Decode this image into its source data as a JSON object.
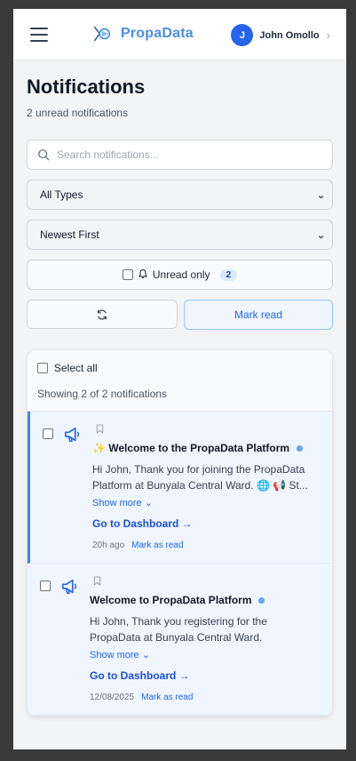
{
  "header": {
    "brand": "PropaData",
    "user_initial": "J",
    "user_name": "John Omollo",
    "chevron": "›",
    "accent": "#4a90e2",
    "avatar_color": "#2563eb"
  },
  "page": {
    "title": "Notifications",
    "subtitle": "2 unread notifications"
  },
  "filters": {
    "search_placeholder": "Search notifications...",
    "type_select": "All Types",
    "sort_select": "Newest First",
    "unread_only_label": "Unread only",
    "unread_count": "2",
    "mark_read_label": "Mark read"
  },
  "list": {
    "select_all_label": "Select all",
    "showing_text": "Showing 2 of 2 notifications",
    "items": [
      {
        "title": "✨ Welcome to the PropaData Platform",
        "body": "Hi John, Thank you for joining the PropaData Platform at Bunyala Central Ward. 🌐 📢 St...",
        "show_more": "Show more ⌄",
        "cta": "Go to Dashboard →",
        "time": "20h ago",
        "mark_label": "Mark as read",
        "icon": "megaphone-icon"
      },
      {
        "title": "Welcome to PropaData Platform",
        "body": "Hi John, Thank you registering for the PropaData at Bunyala Central Ward.",
        "show_more": "Show more ⌄",
        "cta": "Go to Dashboard →",
        "time": "12/08/2025",
        "mark_label": "Mark as read",
        "icon": "megaphone-icon"
      }
    ]
  }
}
